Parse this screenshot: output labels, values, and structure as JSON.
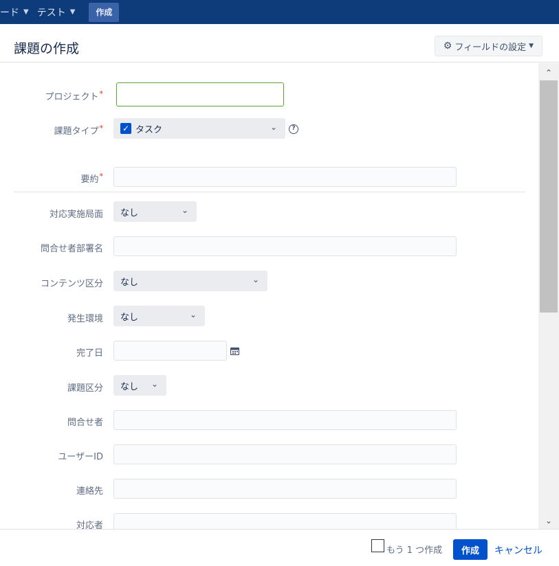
{
  "nav": {
    "items": [
      {
        "label": "ード",
        "chevron": "⌄"
      },
      {
        "label": "テスト",
        "chevron": "⌄"
      }
    ],
    "create_label": "作成"
  },
  "dialog": {
    "title": "課題の作成",
    "field_config_label": "フィールドの設定",
    "icons": {
      "gear": "gear-icon",
      "caret": "caret-down-icon"
    }
  },
  "form": {
    "project": {
      "label": "プロジェクト",
      "required": "*",
      "value": ""
    },
    "issue_type": {
      "label": "課題タイプ",
      "required": "*",
      "value": "タスク",
      "icon": "checkbox-checked-icon",
      "help": "?"
    },
    "summary": {
      "label": "要約",
      "required": "*",
      "value": ""
    },
    "response_phase": {
      "label": "対応実施局面",
      "value": "なし"
    },
    "inquirer_dept": {
      "label": "問合せ者部署名",
      "value": ""
    },
    "content_category": {
      "label": "コンテンツ区分",
      "value": "なし"
    },
    "environment": {
      "label": "発生環境",
      "value": "なし"
    },
    "due_date": {
      "label": "完了日",
      "value": "",
      "icon": "calendar-icon"
    },
    "issue_category": {
      "label": "課題区分",
      "value": "なし"
    },
    "inquirer": {
      "label": "問合せ者",
      "value": ""
    },
    "user_id": {
      "label": "ユーザーID",
      "value": ""
    },
    "contact": {
      "label": "連絡先",
      "value": ""
    },
    "assignee": {
      "label": "対応者",
      "value": ""
    }
  },
  "footer": {
    "create_another_label": "もう 1 つ作成",
    "create_button": "作成",
    "cancel_link": "キャンセル"
  },
  "colors": {
    "nav_bg": "#0e3b7a",
    "primary": "#0052cc",
    "required": "#de350b",
    "focus_border": "#5aa832"
  }
}
